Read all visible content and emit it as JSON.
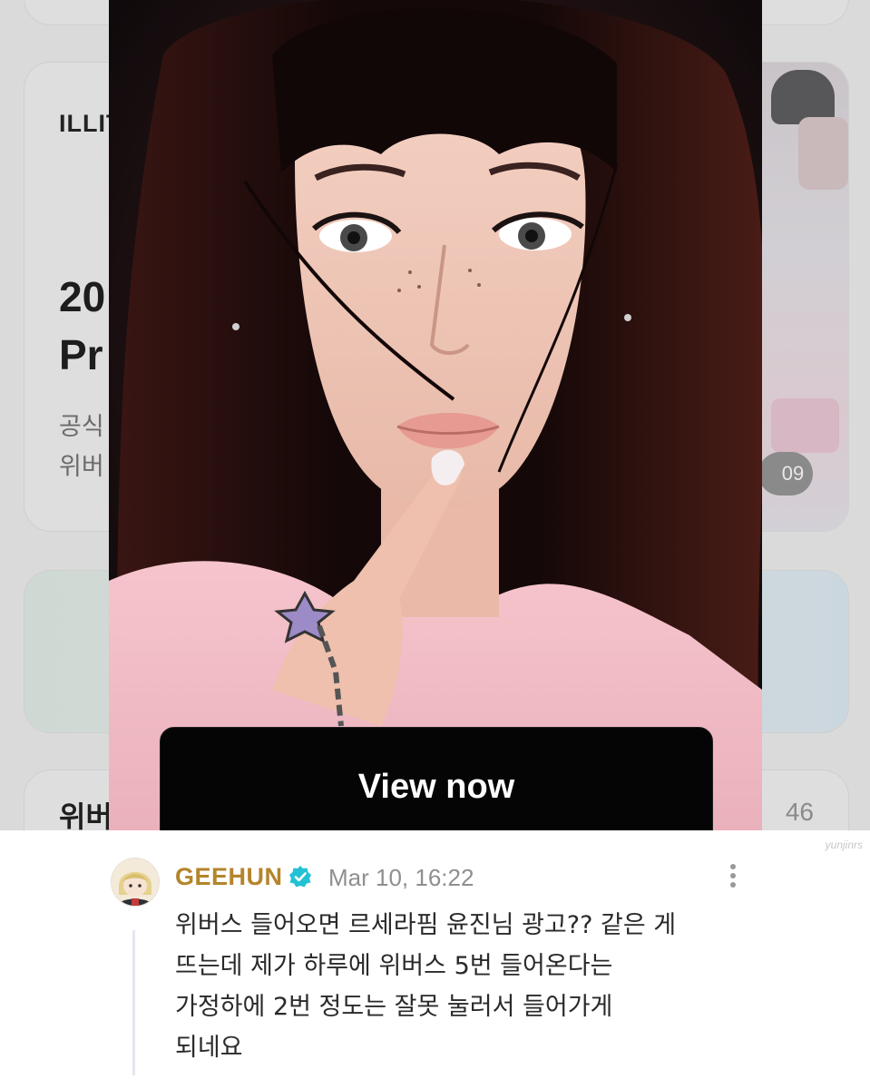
{
  "background_screen": {
    "brand_fragment": "ILLIT",
    "headline_fragment_lines": [
      "20",
      "Pr"
    ],
    "description_fragment_lines": [
      "공식",
      "위버"
    ],
    "image_counter": "09",
    "lower_left_fragment": "위버",
    "lower_right_fragment": "46",
    "dim_overlay": true
  },
  "ad": {
    "image_subject": "portrait-photo",
    "button_label": "View now"
  },
  "watermark": "yunjinrs",
  "comment": {
    "author": "GEEHUN",
    "verified": true,
    "timestamp": "Mar 10, 16:22",
    "text_lines": [
      "위버스 들어오면 르세라핌 윤진님 광고?? 같은 게",
      "뜨는데 제가 하루에 위버스 5번 들어온다는",
      "가정하에 2번 정도는 잘못 눌러서 들어가게",
      "되네요"
    ]
  },
  "colors": {
    "author": "#b5842b",
    "verified_badge": "#23c1d4",
    "timestamp": "#8f8f8f",
    "comment_text": "#2a2a2a",
    "ad_button_bg": "#050505",
    "dimmed_background": "#dadada"
  }
}
